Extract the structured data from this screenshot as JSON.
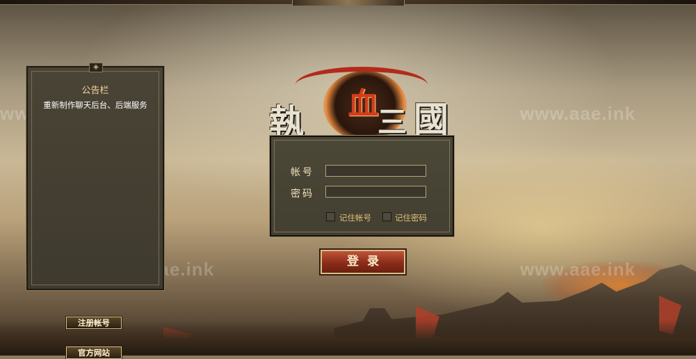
{
  "watermarks": [
    "www.aae.ink",
    "www.aae.ink",
    "www.aae.ink",
    "www.aae.ink"
  ],
  "logo": {
    "char_left": "執",
    "char_mid": "血",
    "char_right1": "三",
    "char_right2": "國"
  },
  "notice": {
    "title": "公告栏",
    "body": "重新制作聊天后台、后端服务",
    "knot_icon": "knot-ornament"
  },
  "login": {
    "account_label": "帐号",
    "password_label": "密码",
    "account_value": "",
    "password_value": "",
    "remember_account_label": "记住帐号",
    "remember_password_label": "记住密码",
    "remember_account_checked": false,
    "remember_password_checked": false,
    "submit_label": "登录"
  },
  "side_buttons": {
    "register_label": "注册帐号",
    "website_label": "官方网站"
  },
  "colors": {
    "accent_gold": "#f2d79a",
    "button_red": "#8a2c1a",
    "panel_bg": "#433f31"
  }
}
